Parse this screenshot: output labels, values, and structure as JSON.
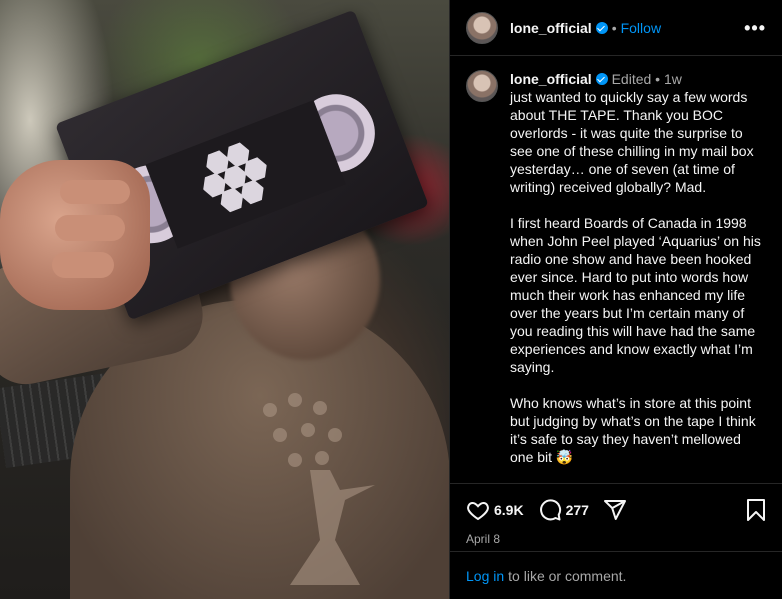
{
  "header": {
    "username": "lone_official",
    "separator": "•",
    "follow_label": "Follow",
    "more_label": "•••"
  },
  "caption": {
    "username": "lone_official",
    "edited_label": "Edited",
    "separator": "•",
    "age": "1w",
    "paragraphs": [
      "just wanted to quickly say a few words about THE TAPE. Thank you BOC overlords - it was quite the surprise to see one of these chilling in my mail box yesterday… one of seven (at time of writing) received globally? Mad.",
      "I first heard Boards of Canada in 1998 when John Peel played ‘Aquarius’ on his radio one show and have been hooked ever since. Hard to put into words how much their work has enhanced my life over the years but I’m certain many of you reading this will have had the same experiences and know exactly what I’m saying.",
      "Who knows what’s in store at this point but judging by what’s on the tape I think it’s safe to say they haven’t mellowed one bit 🤯"
    ]
  },
  "actions": {
    "likes": "6.9K",
    "comments": "277",
    "date": "April 8"
  },
  "footer": {
    "login_label": "Log in",
    "rest_label": "to like or comment."
  },
  "colors": {
    "accent": "#0095f6",
    "background": "#000000",
    "muted_text": "#a8a8a8",
    "divider": "#262626"
  }
}
